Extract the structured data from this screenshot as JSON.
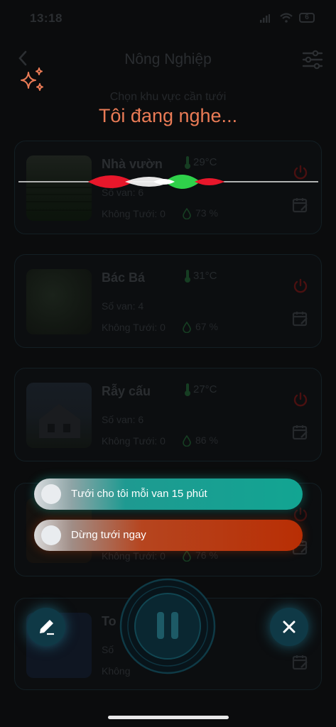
{
  "status_bar": {
    "time": "13:18",
    "battery": "6"
  },
  "header": {
    "title": "Nông Nghiệp"
  },
  "voice": {
    "subtitle": "Chọn khu vực cần tưới",
    "listening_text": "Tôi đang nghe..."
  },
  "areas": [
    {
      "name": "Nhà vườn",
      "temperature": "29°C",
      "valves": "Số van: 6",
      "not_watering": "Không Tưới: 0",
      "humidity": "73 %"
    },
    {
      "name": "Bác Bá",
      "temperature": "31°C",
      "valves": "Số van: 4",
      "not_watering": "Không Tưới: 0",
      "humidity": "67 %"
    },
    {
      "name": "Rẫy cấu",
      "temperature": "27°C",
      "valves": "Số van: 6",
      "not_watering": "Không Tưới: 0",
      "humidity": "86 %"
    },
    {
      "name": "",
      "temperature": "",
      "valves": "",
      "not_watering": "Không Tưới: 0",
      "humidity": "76 %"
    },
    {
      "name": "To",
      "temperature": "",
      "valves": "Số",
      "not_watering": "Không",
      "humidity": ""
    }
  ],
  "suggestions": [
    {
      "label": "Tưới cho tôi mỗi van 15 phút"
    },
    {
      "label": "Dừng tưới ngay"
    }
  ],
  "colors": {
    "accent_listening": "#ea7b56",
    "chip_teal": "#12a592",
    "chip_orange": "#b82e04",
    "control_button": "#0f3946"
  },
  "icons": {
    "back": "chevron-left-icon",
    "filter": "sliders-icon",
    "sparkle": "sparkle-icon",
    "power": "power-icon",
    "calendar": "calendar-edit-icon",
    "edit": "pencil-icon",
    "close": "close-icon",
    "pause": "pause-icon"
  }
}
